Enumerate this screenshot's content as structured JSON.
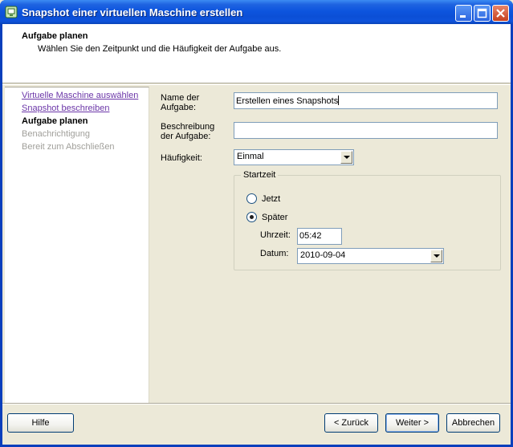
{
  "window": {
    "title": "Snapshot einer virtuellen Maschine erstellen",
    "title_icon": "vm-snapshot-icon",
    "controls": [
      "minimize",
      "maximize",
      "close"
    ]
  },
  "header": {
    "title": "Aufgabe planen",
    "subtitle": "Wählen Sie den Zeitpunkt und die Häufigkeit der Aufgabe aus."
  },
  "nav": {
    "items": [
      {
        "label": "Virtuelle Maschine auswählen",
        "state": "link"
      },
      {
        "label": "Snapshot beschreiben",
        "state": "link"
      },
      {
        "label": "Aufgabe planen",
        "state": "current"
      },
      {
        "label": "Benachrichtigung",
        "state": "disabled"
      },
      {
        "label": "Bereit zum Abschließen",
        "state": "disabled"
      }
    ]
  },
  "form": {
    "task_name_label_1": "Name der",
    "task_name_label_2": "Aufgabe:",
    "task_name_value": "Erstellen eines Snapshots",
    "description_label_1": "Beschreibung",
    "description_label_2": "der Aufgabe:",
    "description_value": "",
    "frequency_label": "Häufigkeit:",
    "frequency_value": "Einmal",
    "start_group_label": "Startzeit",
    "now_label": "Jetzt",
    "later_label": "Später",
    "selected_start": "later",
    "time_label": "Uhrzeit:",
    "time_value": "05:42",
    "date_label": "Datum:",
    "date_value": "2010-09-04"
  },
  "buttons": {
    "help": "Hilfe",
    "back": "< Zurück",
    "next": "Weiter >",
    "cancel": "Abbrechen"
  }
}
